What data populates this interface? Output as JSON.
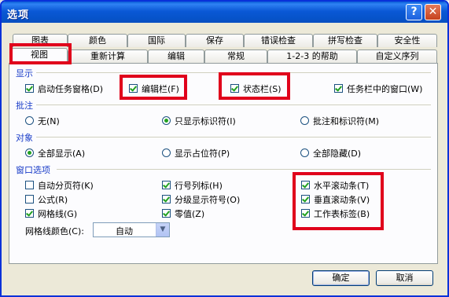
{
  "window": {
    "title": "选项"
  },
  "titlebar": {
    "help_icon": "?",
    "close_icon": "✕"
  },
  "tabs_back": [
    "图表",
    "颜色",
    "国际",
    "保存",
    "错误检查",
    "拼写检查",
    "安全性"
  ],
  "tabs_front": [
    "视图",
    "重新计算",
    "编辑",
    "常规",
    "1-2-3 的帮助",
    "自定义序列"
  ],
  "active_tab": "视图",
  "sections": {
    "display": {
      "label": "显示",
      "items": [
        {
          "label": "启动任务窗格(D)",
          "checked": true
        },
        {
          "label": "编辑栏(F)",
          "checked": true
        },
        {
          "label": "状态栏(S)",
          "checked": true
        },
        {
          "label": "任务栏中的窗口(W)",
          "checked": true
        }
      ]
    },
    "comments": {
      "label": "批注",
      "items": [
        {
          "label": "无(N)",
          "selected": false
        },
        {
          "label": "只显示标识符(I)",
          "selected": true
        },
        {
          "label": "批注和标识符(M)",
          "selected": false
        }
      ]
    },
    "objects": {
      "label": "对象",
      "items": [
        {
          "label": "全部显示(A)",
          "selected": true
        },
        {
          "label": "显示占位符(P)",
          "selected": false
        },
        {
          "label": "全部隐藏(D)",
          "selected": false
        }
      ]
    },
    "window_options": {
      "label": "窗口选项",
      "col1": [
        {
          "label": "自动分页符(K)",
          "checked": false
        },
        {
          "label": "公式(R)",
          "checked": false
        },
        {
          "label": "网格线(G)",
          "checked": true
        }
      ],
      "col2": [
        {
          "label": "行号列标(H)",
          "checked": true
        },
        {
          "label": "分级显示符号(O)",
          "checked": true
        },
        {
          "label": "零值(Z)",
          "checked": true
        }
      ],
      "col3": [
        {
          "label": "水平滚动条(T)",
          "checked": true
        },
        {
          "label": "垂直滚动条(V)",
          "checked": true
        },
        {
          "label": "工作表标签(B)",
          "checked": true
        }
      ]
    }
  },
  "gridline_color": {
    "label": "网格线颜色(C):",
    "value": "自动"
  },
  "buttons": {
    "ok": "确定",
    "cancel": "取消"
  },
  "highlight_color": "#e0001b"
}
